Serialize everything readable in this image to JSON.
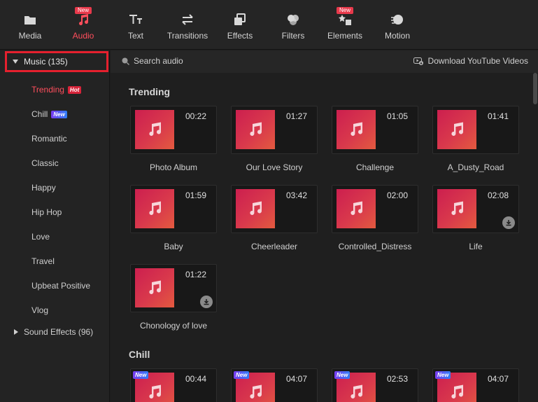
{
  "toolbar": {
    "items": [
      {
        "label": "Media",
        "icon": "folder-icon"
      },
      {
        "label": "Audio",
        "icon": "music-note-icon",
        "badge": "New",
        "active": true
      },
      {
        "label": "Text",
        "icon": "text-icon"
      },
      {
        "label": "Transitions",
        "icon": "transitions-icon"
      },
      {
        "label": "Effects",
        "icon": "effects-icon"
      },
      {
        "label": "Filters",
        "icon": "filters-icon"
      },
      {
        "label": "Elements",
        "icon": "elements-icon",
        "badge": "New"
      },
      {
        "label": "Motion",
        "icon": "motion-icon"
      }
    ]
  },
  "sidebar": {
    "music_header": "Music (135)",
    "categories": [
      {
        "label": "Trending",
        "badge": "Hot",
        "active": true
      },
      {
        "label": "Chill",
        "badge": "New"
      },
      {
        "label": "Romantic"
      },
      {
        "label": "Classic"
      },
      {
        "label": "Happy"
      },
      {
        "label": "Hip Hop"
      },
      {
        "label": "Love"
      },
      {
        "label": "Travel"
      },
      {
        "label": "Upbeat Positive"
      },
      {
        "label": "Vlog"
      }
    ],
    "sound_effects": "Sound Effects (96)"
  },
  "search": {
    "placeholder": "Search audio"
  },
  "download_youtube": "Download YouTube Videos",
  "sections": [
    {
      "title": "Trending",
      "cards": [
        {
          "name": "Photo Album",
          "duration": "00:22"
        },
        {
          "name": "Our Love Story",
          "duration": "01:27"
        },
        {
          "name": "Challenge",
          "duration": "01:05"
        },
        {
          "name": "A_Dusty_Road",
          "duration": "01:41"
        },
        {
          "name": "Baby",
          "duration": "01:59"
        },
        {
          "name": "Cheerleader",
          "duration": "03:42"
        },
        {
          "name": "Controlled_Distress",
          "duration": "02:00"
        },
        {
          "name": "Life",
          "duration": "02:08",
          "download": true
        },
        {
          "name": "Chonology of love",
          "duration": "01:22",
          "download": true
        }
      ]
    },
    {
      "title": "Chill",
      "cards": [
        {
          "name": "",
          "duration": "00:44",
          "badge": "New"
        },
        {
          "name": "",
          "duration": "04:07",
          "badge": "New"
        },
        {
          "name": "",
          "duration": "02:53",
          "badge": "New"
        },
        {
          "name": "",
          "duration": "04:07",
          "badge": "New"
        }
      ]
    }
  ],
  "colors": {
    "accent": "#ff4e5c",
    "highlight_border": "#e5202e",
    "card_gradient_start": "#cc1f4f",
    "card_gradient_end": "#e35a3f"
  }
}
